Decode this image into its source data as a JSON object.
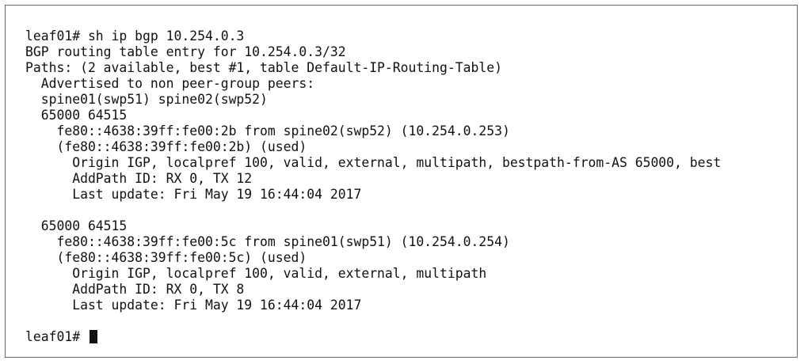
{
  "terminal": {
    "lines": [
      "leaf01# sh ip bgp 10.254.0.3",
      "BGP routing table entry for 10.254.0.3/32",
      "Paths: (2 available, best #1, table Default-IP-Routing-Table)",
      "  Advertised to non peer-group peers:",
      "  spine01(swp51) spine02(swp52)",
      "  65000 64515",
      "    fe80::4638:39ff:fe00:2b from spine02(swp52) (10.254.0.253)",
      "    (fe80::4638:39ff:fe00:2b) (used)",
      "      Origin IGP, localpref 100, valid, external, multipath, bestpath-from-AS 65000, best",
      "      AddPath ID: RX 0, TX 12",
      "      Last update: Fri May 19 16:44:04 2017",
      "",
      "  65000 64515",
      "    fe80::4638:39ff:fe00:5c from spine01(swp51) (10.254.0.254)",
      "    (fe80::4638:39ff:fe00:5c) (used)",
      "      Origin IGP, localpref 100, valid, external, multipath",
      "      AddPath ID: RX 0, TX 8",
      "      Last update: Fri May 19 16:44:04 2017",
      ""
    ],
    "prompt": "leaf01# "
  }
}
